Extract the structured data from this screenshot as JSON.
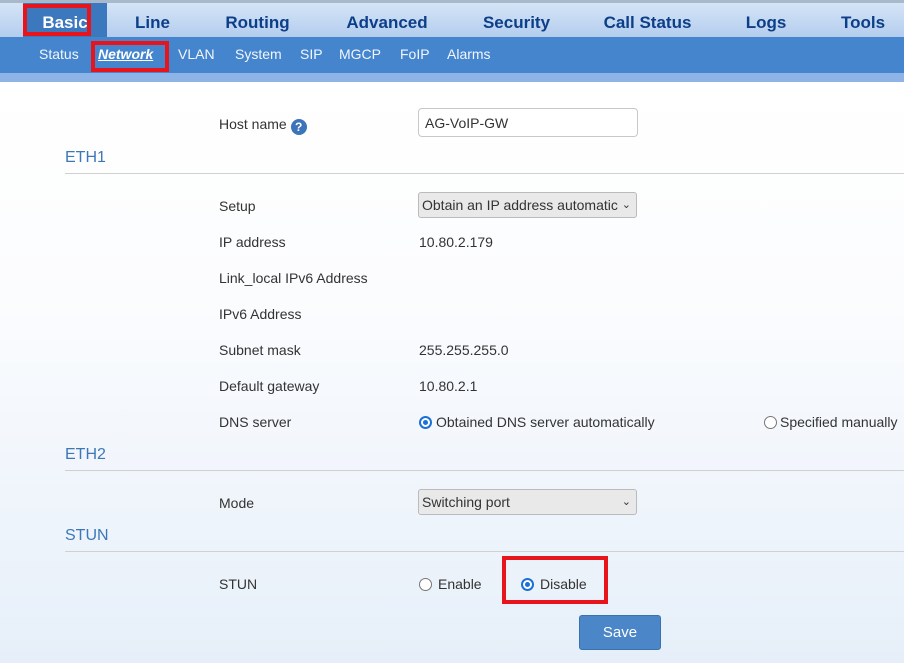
{
  "nav": {
    "tabs": [
      "Basic",
      "Line",
      "Routing",
      "Advanced",
      "Security",
      "Call Status",
      "Logs",
      "Tools"
    ],
    "active": "Basic"
  },
  "subnav": {
    "items": [
      "Status",
      "Network",
      "VLAN",
      "System",
      "SIP",
      "MGCP",
      "FoIP",
      "Alarms"
    ],
    "active": "Network"
  },
  "form": {
    "host_name_label": "Host name",
    "help_icon": "?",
    "host_name_value": "AG-VoIP-GW",
    "eth1_title": "ETH1",
    "setup_label": "Setup",
    "setup_value": "Obtain an IP address automatic",
    "ip_label": "IP address",
    "ip_value": "10.80.2.179",
    "ll6_label": "Link_local IPv6 Address",
    "ipv6_label": "IPv6 Address",
    "mask_label": "Subnet mask",
    "mask_value": "255.255.255.0",
    "gw_label": "Default gateway",
    "gw_value": "10.80.2.1",
    "dns_label": "DNS server",
    "dns_auto": "Obtained DNS server automatically",
    "dns_manual": "Specified manually",
    "dns_selected": "auto",
    "eth2_title": "ETH2",
    "mode_label": "Mode",
    "mode_value": "Switching port",
    "stun_title": "STUN",
    "stun_label": "STUN",
    "stun_enable": "Enable",
    "stun_disable": "Disable",
    "stun_selected": "disable",
    "save": "Save"
  },
  "colors": {
    "accent": "#4485cd",
    "highlight": "#e8141c"
  }
}
